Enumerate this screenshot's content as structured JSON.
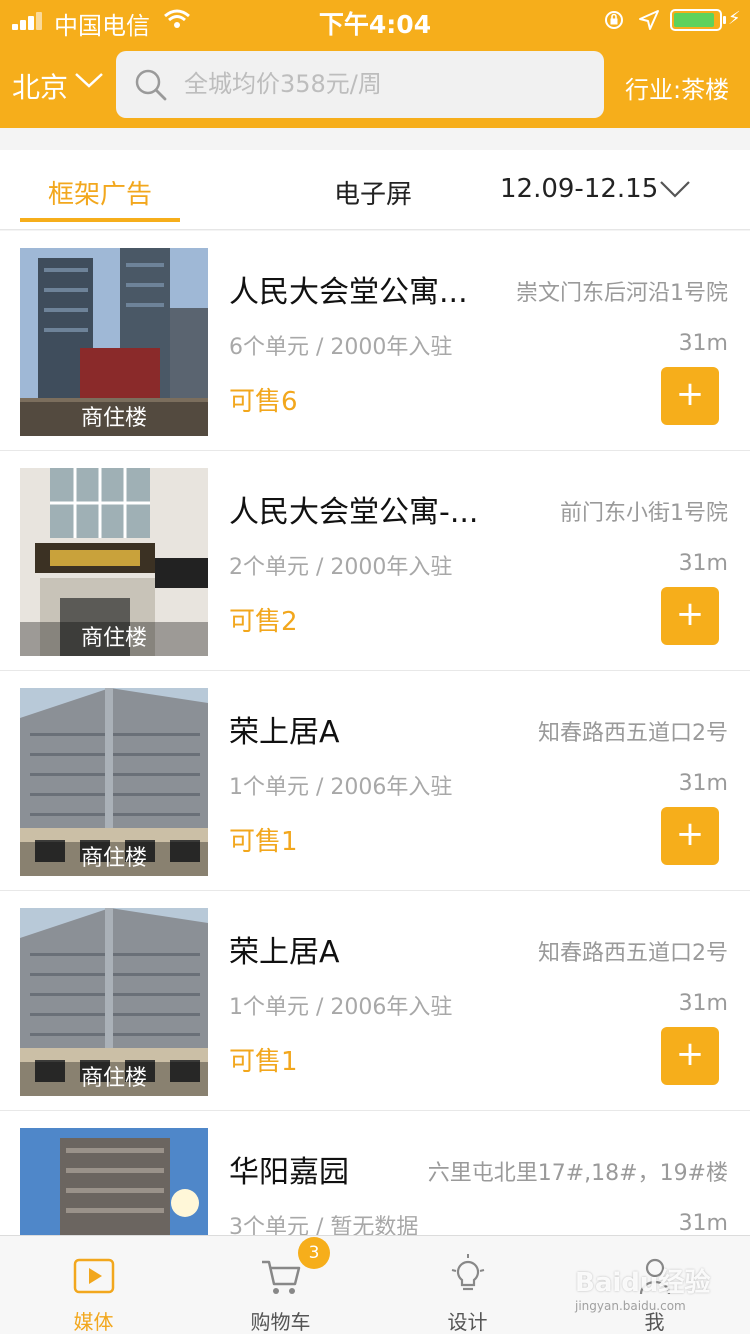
{
  "status_bar": {
    "carrier": "中国电信",
    "time": "下午4:04"
  },
  "header": {
    "city": "北京",
    "search_placeholder": "全城均价358元/周",
    "industry": "行业:茶楼"
  },
  "tabs": {
    "active": "框架广告",
    "second": "电子屏",
    "date_range": "12.09-12.15"
  },
  "listings": [
    {
      "name": "人民大会堂公寓...",
      "address": "崇文门东后河沿1号院",
      "meta": "6个单元 / 2000年入驻",
      "distance": "31m",
      "sale": "可售6",
      "thumb_label": "商住楼",
      "add_label": "+"
    },
    {
      "name": "人民大会堂公寓-...",
      "address": "前门东小街1号院",
      "meta": "2个单元 / 2000年入驻",
      "distance": "31m",
      "sale": "可售2",
      "thumb_label": "商住楼",
      "add_label": "+"
    },
    {
      "name": "荣上居A",
      "address": "知春路西五道口2号",
      "meta": "1个单元 / 2006年入驻",
      "distance": "31m",
      "sale": "可售1",
      "thumb_label": "商住楼",
      "add_label": "+"
    },
    {
      "name": "荣上居A",
      "address": "知春路西五道口2号",
      "meta": "1个单元 / 2006年入驻",
      "distance": "31m",
      "sale": "可售1",
      "thumb_label": "商住楼",
      "add_label": "+"
    },
    {
      "name": "华阳嘉园",
      "address": "六里屯北里17#,18#，19#楼",
      "meta": "3个单元 / 暂无数据",
      "distance": "31m",
      "sale": "",
      "thumb_label": "",
      "add_label": ""
    }
  ],
  "bottom_nav": {
    "media": "媒体",
    "cart": "购物车",
    "cart_badge": "3",
    "design": "设计",
    "me": "我"
  },
  "watermark": {
    "brand": "Baidu经验",
    "url": "jingyan.baidu.com"
  },
  "colors": {
    "accent": "#f6ae1b",
    "accent_text": "#f2a71d"
  }
}
